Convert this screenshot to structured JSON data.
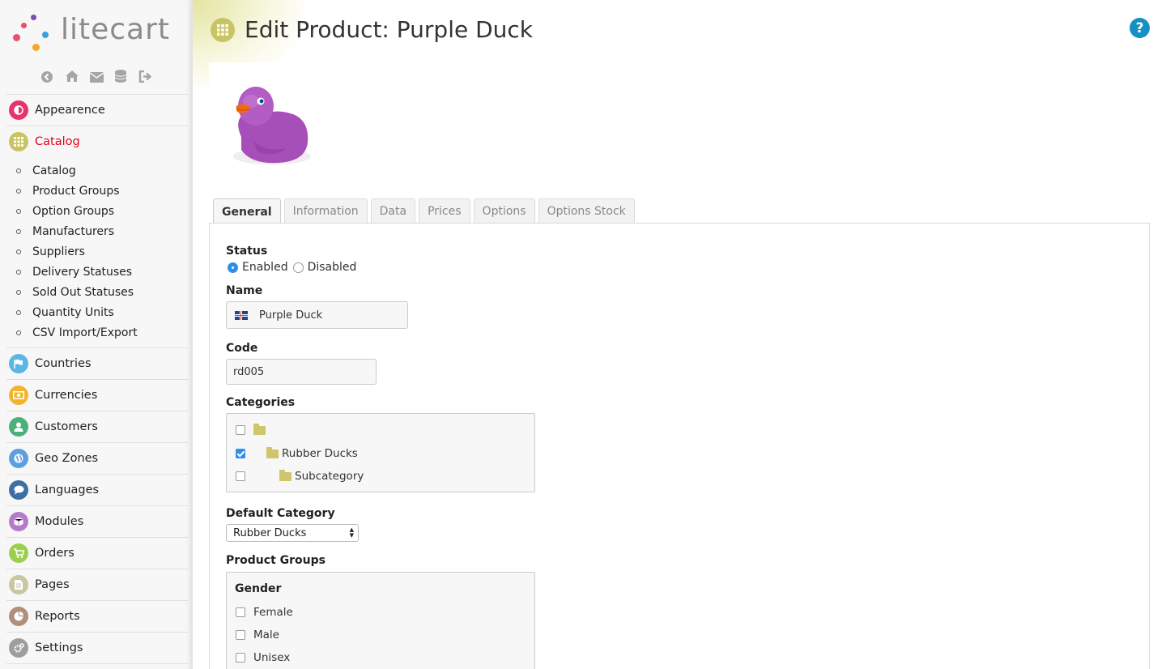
{
  "app": {
    "logo_text": "litecart"
  },
  "sidebar": {
    "top_icons": [
      "back-icon",
      "home-icon",
      "mail-icon",
      "database-icon",
      "logout-icon"
    ],
    "menu": [
      {
        "label": "Appearence",
        "icon": "contrast-icon",
        "color": "#e8346b"
      },
      {
        "label": "Catalog",
        "icon": "grid-icon",
        "color": "#c9c463",
        "active": true
      },
      {
        "label": "Countries",
        "icon": "flag-icon",
        "color": "#5bb6e3"
      },
      {
        "label": "Currencies",
        "icon": "money-icon",
        "color": "#f1b52d"
      },
      {
        "label": "Customers",
        "icon": "user-icon",
        "color": "#4cb07d"
      },
      {
        "label": "Geo Zones",
        "icon": "globe-icon",
        "color": "#5d9fe0"
      },
      {
        "label": "Languages",
        "icon": "chat-icon",
        "color": "#3e6fa4"
      },
      {
        "label": "Modules",
        "icon": "cube-icon",
        "color": "#b57bc9"
      },
      {
        "label": "Orders",
        "icon": "cart-icon",
        "color": "#9bcf4c"
      },
      {
        "label": "Pages",
        "icon": "file-icon",
        "color": "#c7c7a0"
      },
      {
        "label": "Reports",
        "icon": "pie-icon",
        "color": "#b0907a"
      },
      {
        "label": "Settings",
        "icon": "cogs-icon",
        "color": "#9e9e9e"
      }
    ],
    "catalog_submenu": [
      "Catalog",
      "Product Groups",
      "Option Groups",
      "Manufacturers",
      "Suppliers",
      "Delivery Statuses",
      "Sold Out Statuses",
      "Quantity Units",
      "CSV Import/Export"
    ]
  },
  "page": {
    "title": "Edit Product: Purple Duck",
    "help": "?"
  },
  "tabs": [
    {
      "label": "General",
      "active": true
    },
    {
      "label": "Information"
    },
    {
      "label": "Data"
    },
    {
      "label": "Prices"
    },
    {
      "label": "Options"
    },
    {
      "label": "Options Stock"
    }
  ],
  "form": {
    "status": {
      "label": "Status",
      "options": [
        "Enabled",
        "Disabled"
      ],
      "selected": "Enabled"
    },
    "name": {
      "label": "Name",
      "value": "Purple Duck"
    },
    "code": {
      "label": "Code",
      "value": "rd005"
    },
    "categories": {
      "label": "Categories",
      "items": [
        {
          "label": "",
          "checked": false
        },
        {
          "label": "Rubber Ducks",
          "checked": true
        },
        {
          "label": "Subcategory",
          "checked": false
        }
      ]
    },
    "default_category": {
      "label": "Default Category",
      "value": "Rubber Ducks"
    },
    "product_groups": {
      "label": "Product Groups",
      "group_name": "Gender",
      "items": [
        {
          "label": "Female",
          "checked": false
        },
        {
          "label": "Male",
          "checked": false
        },
        {
          "label": "Unisex",
          "checked": false
        }
      ]
    }
  }
}
